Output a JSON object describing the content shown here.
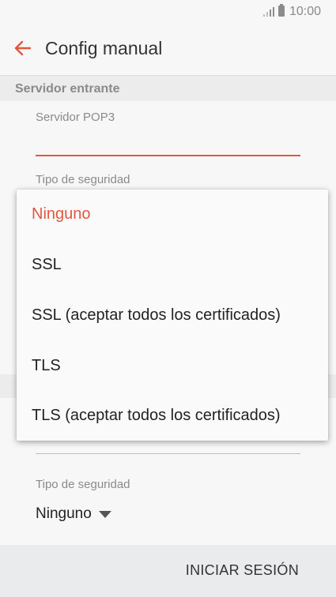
{
  "status_bar": {
    "time": "10:00"
  },
  "app_bar": {
    "title": "Config manual"
  },
  "section": {
    "incoming_server": "Servidor entrante"
  },
  "fields": {
    "pop3_label": "Servidor POP3",
    "pop3_value": "",
    "security_label_top": "Tipo de seguridad",
    "security_label_bottom": "Tipo de seguridad",
    "security_value_bottom": "Ninguno"
  },
  "dropdown": {
    "options": [
      {
        "label": "Ninguno",
        "selected": true
      },
      {
        "label": "SSL",
        "selected": false
      },
      {
        "label": "SSL (aceptar todos los certificados)",
        "selected": false
      },
      {
        "label": "TLS",
        "selected": false
      },
      {
        "label": "TLS (aceptar todos los certificados)",
        "selected": false
      }
    ]
  },
  "footer": {
    "login_button": "INICIAR SESIÓN"
  },
  "colors": {
    "accent": "#e0593e",
    "background": "#f7f7f7",
    "section_bg": "#ececec"
  }
}
